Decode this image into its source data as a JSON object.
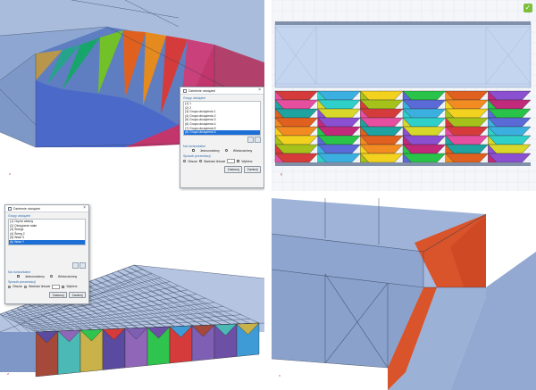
{
  "dialog1": {
    "title": "Dzielenie obciążeń",
    "groups_label": "Grupy obciążeń",
    "items": [
      "(1) 1",
      "(2) 2",
      "(3) Grupa obciążenia 1",
      "(4) Grupa obciążenia 2",
      "(5) Grupa obciążenia 3",
      "(6) Grupa obciążenia 4",
      "(7) Grupa obciążenia 5",
      "(8) Grupa obciążenia 6"
    ],
    "selected_index": 7,
    "orientation_label": "Na horizontalne",
    "opt_a": "Jednorodzinny",
    "opt_b": "Wielorodzinny",
    "view_label": "Sposób prezentacji",
    "view_a": "Obszar",
    "view_b": "Wartości liniowe",
    "view_c": "Wybierz",
    "btn_ok": "Zastosuj",
    "btn_close": "Zamknij"
  },
  "dialog2": {
    "title": "Dzielenie obciążeń",
    "groups_label": "Grupy obciążeń",
    "items": [
      "(1) Ciężar własny",
      "(2) Obciążenie stałe",
      "(3) Śnieg1",
      "(4) Śnieg 2",
      "(5) Wiatr X",
      "(6) Wiatr Y"
    ],
    "selected_index": 5,
    "orientation_label": "Na horizontalne",
    "opt_a": "Jednorodzinny",
    "opt_b": "Wielorodzinny",
    "view_label": "Sposób prezentacji",
    "view_a": "Obszar",
    "view_b": "Wartości liniowe",
    "view_c": "Wybierz",
    "btn_ok": "Zastosuj",
    "btn_close": "Zamknij"
  },
  "axis": {
    "x": "x",
    "y": "y",
    "z": "z"
  },
  "colors": {
    "model": "#93acd3",
    "model_dark": "#4a6aa6",
    "accent_orange": "#d9542b",
    "selection": "#1d6fd6",
    "check_badge": "#7bbf3a"
  },
  "icons": [
    "check-icon",
    "window-icon",
    "close-icon",
    "axis-icon"
  ]
}
